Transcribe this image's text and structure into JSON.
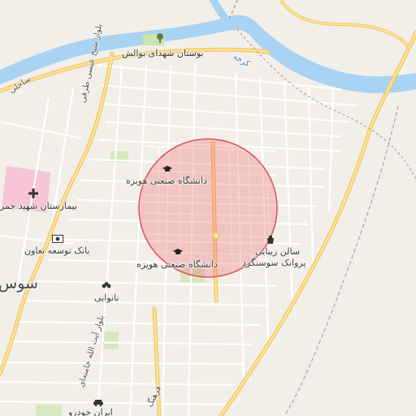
{
  "map": {
    "labels": {
      "park": "بوستان شهدای بوالش",
      "university_north": "دانشگاه صنعتی هویزه",
      "university_south": "دانشگاه صنعتی هویزه",
      "hospital": "بیمارستان شهید جمر",
      "bank": "بانک توسعه تعاون",
      "salon_line1": "سالن زیبایی",
      "salon_line2": "پروانک سوسنگرد",
      "bakery": "نانوایی",
      "car_dealer": "ایران خودرو",
      "city": "سوس",
      "river": "کرخه",
      "road_sahel": "ساحلی",
      "road_sheikh_issa": "بلوار شیخ عیسی طرفی",
      "road_khamenei": "بلوار آیت الله خامنه‌ای",
      "road_south": "فرهنگ"
    },
    "icons": {
      "park": "tree-icon",
      "university_north": "graduation-cap-icon",
      "university_south": "graduation-cap-icon",
      "hospital": "hospital-cross-icon",
      "bank": "bank-icon",
      "salon": "salon-icon",
      "bakery": "bakery-icon",
      "car_dealer": "car-icon"
    },
    "colors": {
      "land": "#f2efe9",
      "water": "#a9d3f2",
      "major_road": "#f7d774",
      "minor_road": "#ffffff",
      "hospital_area": "#f7c6d6",
      "park_area": "#c9e5b0",
      "highlight_circle": "#e8555a"
    }
  }
}
